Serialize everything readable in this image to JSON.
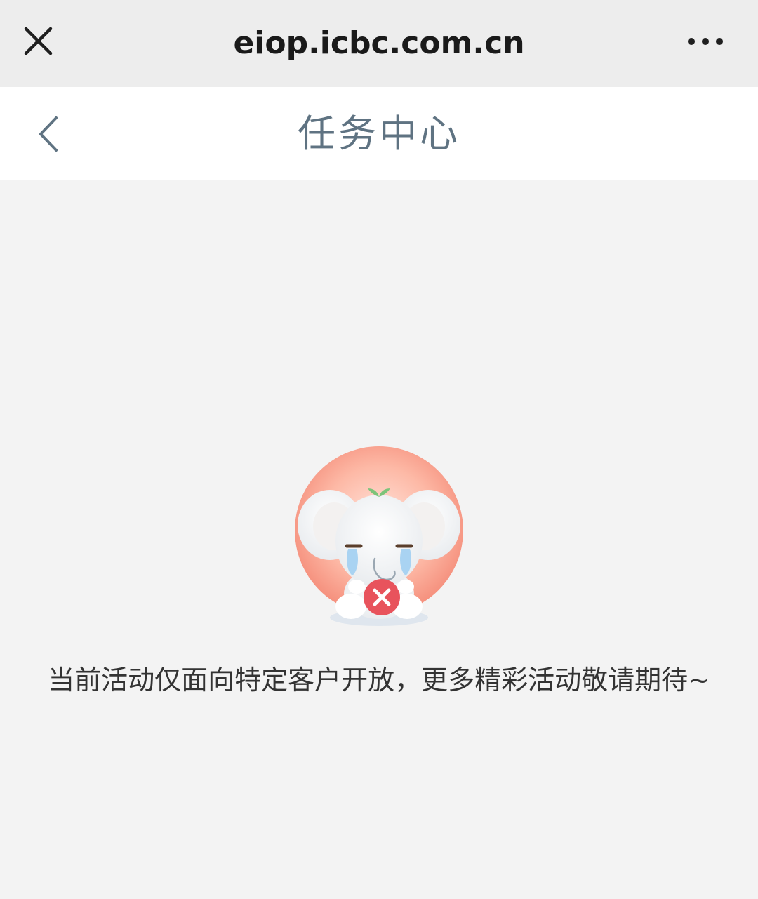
{
  "browser": {
    "url": "eiop.icbc.com.cn",
    "close_icon": "close-icon",
    "more_icon": "more-horizontal-icon"
  },
  "nav": {
    "back_icon": "chevron-left-icon",
    "title": "任务中心"
  },
  "empty_state": {
    "illustration": "sad-elephant-mascot",
    "message": "当前活动仅面向特定客户开放，更多精彩活动敬请期待~"
  },
  "colors": {
    "browser_bar": "#ededed",
    "nav_bar": "#ffffff",
    "background": "#f3f3f3",
    "title": "#5f7382",
    "accent_red": "#e8535c"
  }
}
